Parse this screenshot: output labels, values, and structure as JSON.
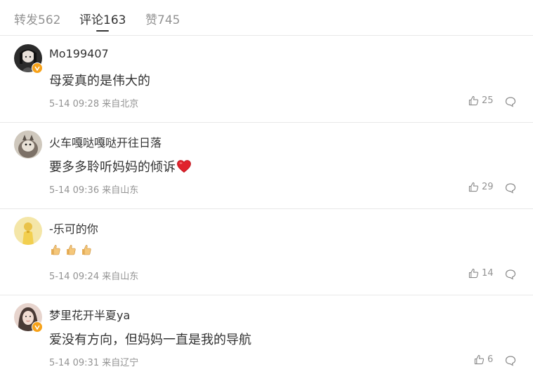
{
  "tabs": [
    {
      "label": "转发562",
      "active": false
    },
    {
      "label": "评论163",
      "active": true
    },
    {
      "label": "赞745",
      "active": false
    }
  ],
  "comments": [
    {
      "username": "Mo199407",
      "text": "母爱真的是伟大的",
      "meta": "5-14 09:28 来自北京",
      "likes": "25",
      "avatar": "avatar-anime-dark",
      "verified": true
    },
    {
      "username": "火车嘎哒嘎哒开往日落",
      "text": "要多多聆听妈妈的倾诉",
      "trailing_icon": "heart-icon",
      "meta": "5-14 09:36 来自山东",
      "likes": "29",
      "avatar": "avatar-cat",
      "verified": false
    },
    {
      "username": "-乐可的你",
      "emojis": [
        "thumbs-up-icon",
        "thumbs-up-icon",
        "thumbs-up-icon"
      ],
      "meta": "5-14 09:24 来自山东",
      "likes": "14",
      "avatar": "avatar-yellow-figure",
      "verified": false
    },
    {
      "username": "梦里花开半夏ya",
      "text": "爱没有方向，但妈妈一直是我的导航",
      "meta": "5-14 09:31 来自辽宁",
      "likes": "6",
      "avatar": "avatar-portrait",
      "verified": true
    }
  ],
  "colors": {
    "accent_badge": "#f7a21a",
    "muted_text": "#939393",
    "heart": "#e0222c"
  }
}
